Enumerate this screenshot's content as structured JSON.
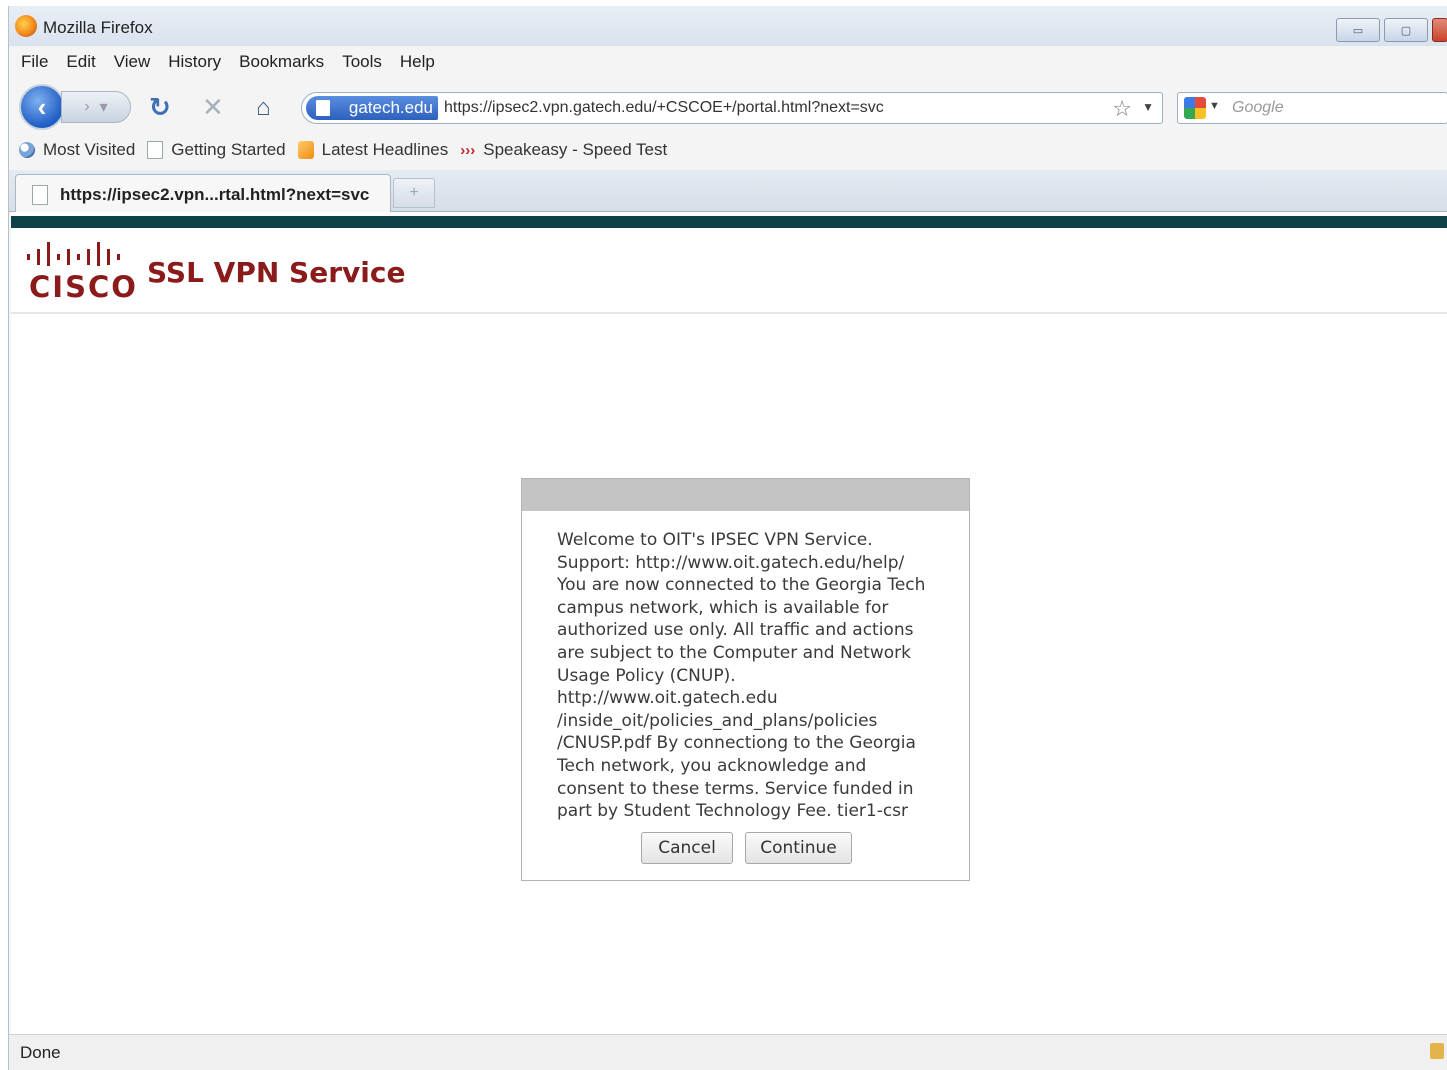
{
  "window": {
    "title": "Mozilla Firefox"
  },
  "menu": [
    "File",
    "Edit",
    "View",
    "History",
    "Bookmarks",
    "Tools",
    "Help"
  ],
  "nav": {
    "identity_label": "gatech.edu",
    "url": "https://ipsec2.vpn.gatech.edu/+CSCOE+/portal.html?next=svc",
    "search_placeholder": "Google"
  },
  "bookmarks": [
    {
      "label": "Most Visited",
      "icon": "most-visited-icon"
    },
    {
      "label": "Getting Started",
      "icon": "page-icon"
    },
    {
      "label": "Latest Headlines",
      "icon": "rss-icon"
    },
    {
      "label": "Speakeasy - Speed Test",
      "icon": "chevron-icon"
    }
  ],
  "tab": {
    "label": "https://ipsec2.vpn...rtal.html?next=svc"
  },
  "header": {
    "brand": "CISCO",
    "title": "SSL VPN Service"
  },
  "dialog": {
    "message": "Welcome to OIT's IPSEC VPN Service. Support: http://www.oit.gatech.edu/help/ You are now connected to the Georgia Tech campus network, which is available for authorized use only. All traffic and actions are subject to the Computer and Network Usage Policy (CNUP). http://www.oit.gatech.edu /inside_oit/policies_and_plans/policies /CNUSP.pdf By connectiong to the Georgia Tech network, you acknowledge and consent to these terms. Service funded in part by Student Technology Fee. tier1-csr",
    "cancel_label": "Cancel",
    "continue_label": "Continue"
  },
  "status": {
    "text": "Done"
  },
  "colors": {
    "accent_dark": "#0e4145",
    "brand_red": "#8b1a1a"
  }
}
